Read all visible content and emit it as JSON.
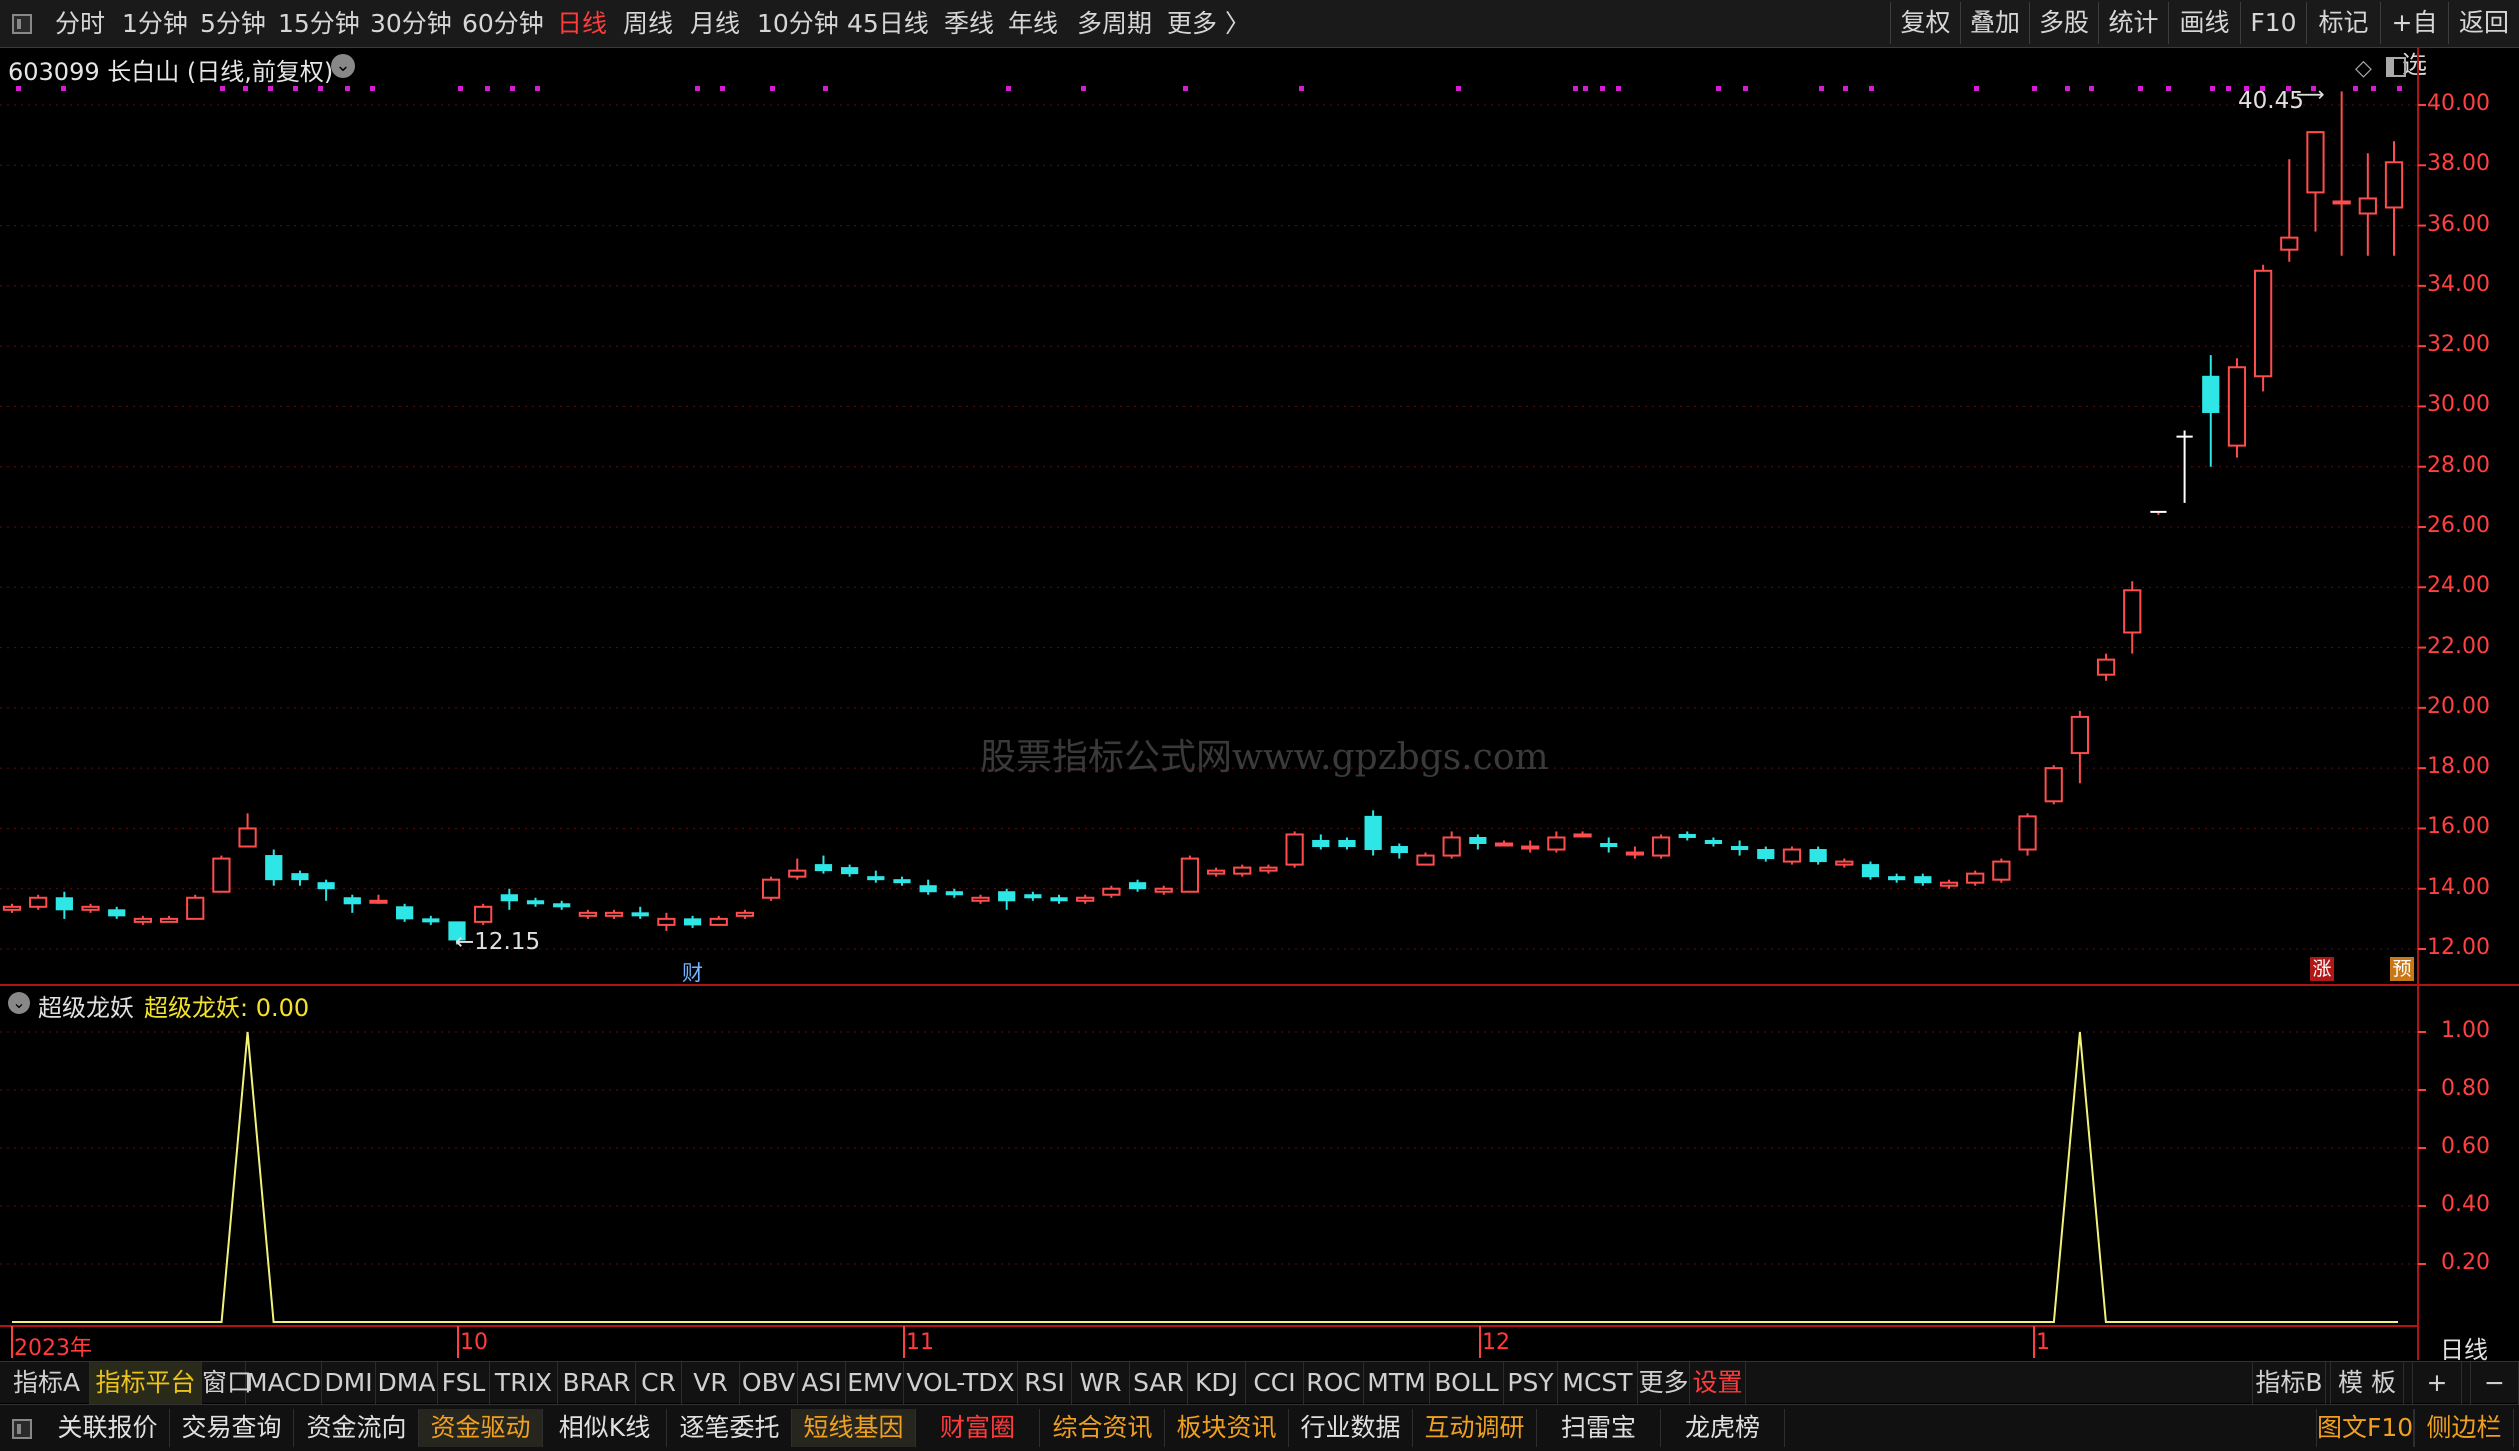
{
  "topbar": {
    "periods": [
      "分时",
      "1分钟",
      "5分钟",
      "15分钟",
      "30分钟",
      "60分钟",
      "日线",
      "周线",
      "月线",
      "10分钟",
      "45日线",
      "季线",
      "年线",
      "多周期",
      "更多 〉"
    ],
    "active_period": "日线",
    "right_buttons": [
      "复权",
      "叠加",
      "多股",
      "统计",
      "画线",
      "F10",
      "标记",
      "+自选",
      "返回"
    ]
  },
  "stock": {
    "code_name": "603099 长白山 (日线,前复权)",
    "max_label": "40.45",
    "min_label": "←12.15",
    "marker_cai": "财",
    "marker_zhang": "涨",
    "marker_yu": "预"
  },
  "indicator": {
    "name": "超级龙妖",
    "value_label": "超级龙妖: 0.00",
    "y_ticks": [
      "1.00",
      "0.80",
      "0.60",
      "0.40",
      "0.20"
    ]
  },
  "price_axis": [
    "40.00",
    "38.00",
    "36.00",
    "34.00",
    "32.00",
    "30.00",
    "28.00",
    "26.00",
    "24.00",
    "22.00",
    "20.00",
    "18.00",
    "16.00",
    "14.00",
    "12.00"
  ],
  "time_axis": [
    "2023年",
    "10",
    "11",
    "12",
    "1"
  ],
  "time_axis_period": "日线",
  "watermark": "股票指标公式网www.gpzbgs.com",
  "tabs": [
    "指标A",
    "指标平台",
    "窗口",
    "MACD",
    "DMI",
    "DMA",
    "FSL",
    "TRIX",
    "BRAR",
    "CR",
    "VR",
    "OBV",
    "ASI",
    "EMV",
    "VOL-TDX",
    "RSI",
    "WR",
    "SAR",
    "KDJ",
    "CCI",
    "ROC",
    "MTM",
    "BOLL",
    "PSY",
    "MCST",
    "更多",
    "设置"
  ],
  "tabs_right": [
    "指标B",
    "模 板",
    "+",
    "−"
  ],
  "bottom_buttons": [
    {
      "label": "关联报价",
      "color": "#e0e0e0"
    },
    {
      "label": "交易查询",
      "color": "#e0e0e0"
    },
    {
      "label": "资金流向",
      "color": "#e0e0e0"
    },
    {
      "label": "资金驱动",
      "color": "#f0a020"
    },
    {
      "label": "相似K线",
      "color": "#e0e0e0"
    },
    {
      "label": "逐笔委托",
      "color": "#e0e0e0"
    },
    {
      "label": "短线基因",
      "color": "#f0a020"
    },
    {
      "label": "财富圈",
      "color": "#ff3b3b"
    },
    {
      "label": "综合资讯",
      "color": "#f0a020"
    },
    {
      "label": "板块资讯",
      "color": "#f0a020"
    },
    {
      "label": "行业数据",
      "color": "#e0e0e0"
    },
    {
      "label": "互动调研",
      "color": "#f0a020"
    },
    {
      "label": "扫雷宝",
      "color": "#e0e0e0"
    },
    {
      "label": "龙虎榜",
      "color": "#e0e0e0"
    }
  ],
  "bottom_right": [
    {
      "label": "图文F10",
      "color": "#f0a020"
    },
    {
      "label": "侧边栏",
      "color": "#f0a020"
    }
  ],
  "colors": {
    "up": "#ff4d4d",
    "down": "#2fe6e6",
    "axis": "#ff4040",
    "grid": "#5a1010",
    "indicator_line": "#f2f27a",
    "marker_dots": "#d020d0"
  },
  "chart_data": {
    "type": "candlestick",
    "y_range": [
      11.5,
      41.2
    ],
    "candles": [
      [
        13.3,
        13.5,
        13.2,
        13.4
      ],
      [
        13.4,
        13.8,
        13.3,
        13.7
      ],
      [
        13.7,
        13.9,
        13.0,
        13.3
      ],
      [
        13.3,
        13.5,
        13.2,
        13.4
      ],
      [
        13.3,
        13.4,
        13.0,
        13.1
      ],
      [
        12.9,
        13.1,
        12.8,
        13.0
      ],
      [
        12.9,
        13.1,
        12.9,
        13.0
      ],
      [
        13.0,
        13.8,
        13.0,
        13.7
      ],
      [
        13.9,
        15.1,
        13.9,
        15.0
      ],
      [
        15.4,
        16.5,
        15.4,
        16.0
      ],
      [
        15.1,
        15.3,
        14.1,
        14.3
      ],
      [
        14.5,
        14.6,
        14.1,
        14.3
      ],
      [
        14.2,
        14.3,
        13.6,
        14.0
      ],
      [
        13.7,
        13.8,
        13.2,
        13.5
      ],
      [
        13.6,
        13.8,
        13.5,
        13.6
      ],
      [
        13.4,
        13.5,
        12.9,
        13.0
      ],
      [
        13.0,
        13.1,
        12.8,
        12.9
      ],
      [
        12.9,
        12.9,
        12.15,
        12.3
      ],
      [
        12.9,
        13.5,
        12.8,
        13.4
      ],
      [
        13.8,
        14.0,
        13.3,
        13.6
      ],
      [
        13.6,
        13.7,
        13.4,
        13.5
      ],
      [
        13.5,
        13.6,
        13.3,
        13.4
      ],
      [
        13.1,
        13.3,
        13.0,
        13.2
      ],
      [
        13.1,
        13.3,
        13.0,
        13.2
      ],
      [
        13.2,
        13.4,
        13.0,
        13.1
      ],
      [
        12.8,
        13.2,
        12.6,
        13.0
      ],
      [
        13.0,
        13.1,
        12.7,
        12.8
      ],
      [
        12.8,
        13.1,
        12.8,
        13.0
      ],
      [
        13.1,
        13.3,
        13.0,
        13.2
      ],
      [
        13.7,
        14.4,
        13.6,
        14.3
      ],
      [
        14.4,
        15.0,
        14.3,
        14.6
      ],
      [
        14.8,
        15.1,
        14.5,
        14.6
      ],
      [
        14.7,
        14.8,
        14.4,
        14.5
      ],
      [
        14.4,
        14.6,
        14.2,
        14.3
      ],
      [
        14.3,
        14.4,
        14.1,
        14.2
      ],
      [
        14.1,
        14.3,
        13.8,
        13.9
      ],
      [
        13.9,
        14.0,
        13.7,
        13.8
      ],
      [
        13.6,
        13.8,
        13.5,
        13.7
      ],
      [
        13.9,
        14.0,
        13.3,
        13.6
      ],
      [
        13.8,
        13.9,
        13.6,
        13.7
      ],
      [
        13.7,
        13.8,
        13.5,
        13.6
      ],
      [
        13.6,
        13.8,
        13.5,
        13.7
      ],
      [
        13.8,
        14.1,
        13.7,
        14.0
      ],
      [
        14.2,
        14.3,
        13.9,
        14.0
      ],
      [
        13.9,
        14.1,
        13.8,
        14.0
      ],
      [
        13.9,
        15.1,
        13.9,
        15.0
      ],
      [
        14.5,
        14.7,
        14.4,
        14.6
      ],
      [
        14.5,
        14.8,
        14.4,
        14.7
      ],
      [
        14.6,
        14.8,
        14.5,
        14.7
      ],
      [
        14.8,
        15.9,
        14.7,
        15.8
      ],
      [
        15.6,
        15.8,
        15.3,
        15.4
      ],
      [
        15.6,
        15.7,
        15.3,
        15.4
      ],
      [
        16.4,
        16.6,
        15.1,
        15.3
      ],
      [
        15.4,
        15.5,
        15.0,
        15.2
      ],
      [
        14.8,
        15.2,
        14.8,
        15.1
      ],
      [
        15.1,
        15.9,
        15.0,
        15.7
      ],
      [
        15.7,
        15.8,
        15.3,
        15.5
      ],
      [
        15.5,
        15.6,
        15.4,
        15.5
      ],
      [
        15.4,
        15.6,
        15.2,
        15.4
      ],
      [
        15.3,
        15.9,
        15.2,
        15.7
      ],
      [
        15.8,
        15.9,
        15.7,
        15.8
      ],
      [
        15.5,
        15.7,
        15.2,
        15.4
      ],
      [
        15.2,
        15.4,
        15.0,
        15.2
      ],
      [
        15.1,
        15.8,
        15.0,
        15.7
      ],
      [
        15.8,
        15.9,
        15.6,
        15.7
      ],
      [
        15.6,
        15.7,
        15.4,
        15.5
      ],
      [
        15.4,
        15.6,
        15.1,
        15.3
      ],
      [
        15.3,
        15.4,
        14.9,
        15.0
      ],
      [
        14.9,
        15.4,
        14.8,
        15.3
      ],
      [
        15.3,
        15.4,
        14.8,
        14.9
      ],
      [
        14.8,
        15.0,
        14.7,
        14.9
      ],
      [
        14.8,
        14.9,
        14.3,
        14.4
      ],
      [
        14.4,
        14.5,
        14.2,
        14.3
      ],
      [
        14.4,
        14.5,
        14.1,
        14.2
      ],
      [
        14.1,
        14.3,
        14.0,
        14.2
      ],
      [
        14.2,
        14.6,
        14.1,
        14.5
      ],
      [
        14.3,
        15.0,
        14.2,
        14.9
      ],
      [
        15.3,
        16.5,
        15.1,
        16.4
      ],
      [
        16.9,
        18.1,
        16.8,
        18.0
      ],
      [
        18.5,
        19.9,
        17.5,
        19.7
      ],
      [
        21.1,
        21.8,
        20.9,
        21.6
      ],
      [
        22.5,
        24.2,
        21.8,
        23.9
      ],
      [
        26.4,
        26.5,
        26.4,
        26.5
      ],
      [
        29.0,
        29.2,
        26.8,
        28.9
      ],
      [
        31.0,
        31.7,
        28.0,
        29.8
      ],
      [
        28.7,
        31.6,
        28.3,
        31.3
      ],
      [
        31.0,
        34.7,
        30.5,
        34.5
      ],
      [
        35.2,
        38.2,
        34.8,
        35.6
      ],
      [
        37.1,
        39.1,
        35.8,
        39.1
      ],
      [
        36.8,
        40.45,
        35.0,
        36.8
      ],
      [
        36.4,
        38.4,
        35.0,
        36.9
      ],
      [
        36.6,
        38.8,
        35.0,
        38.1
      ]
    ],
    "indicator_series": "超级龙妖",
    "indicator_values_summary": "0 everywhere except spikes to 1.00 at two bars (mid-September and early January)",
    "indicator_spike_bars": [
      9,
      79
    ]
  }
}
